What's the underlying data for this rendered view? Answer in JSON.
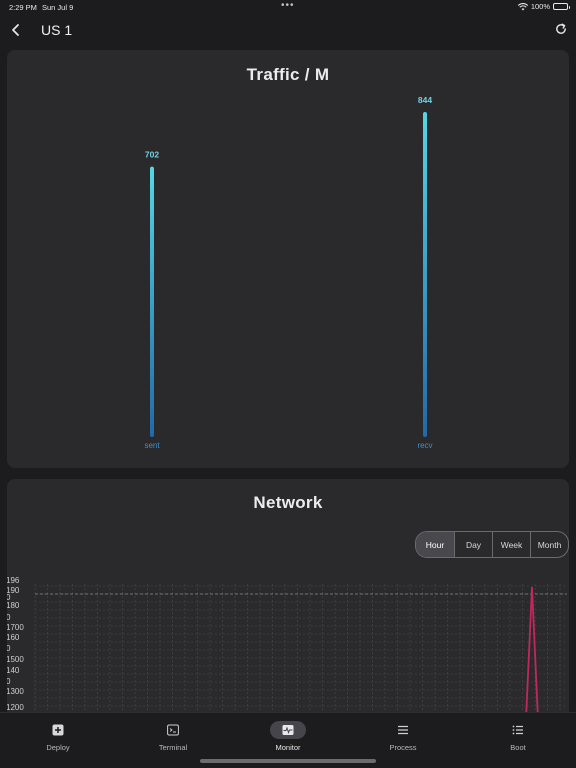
{
  "status": {
    "time": "2:29 PM",
    "date": "Sun Jul 9",
    "battery": "100%"
  },
  "nav": {
    "title": "US 1"
  },
  "traffic": {
    "title": "Traffic / M",
    "bars": [
      {
        "label": "sent",
        "value": 702
      },
      {
        "label": "recv",
        "value": 844
      }
    ]
  },
  "network": {
    "title": "Network",
    "ranges": [
      "Hour",
      "Day",
      "Week",
      "Month"
    ],
    "selected_range": "Hour",
    "axis_labels": [
      "196",
      "190",
      "0",
      "180",
      "0",
      "1700",
      "160",
      "0",
      "1500",
      "140",
      "0",
      "1300",
      "1200"
    ],
    "accent_color": "#c2275f"
  },
  "tabs": [
    {
      "label": "Deploy",
      "icon": "plus-square-icon"
    },
    {
      "label": "Terminal",
      "icon": "terminal-icon"
    },
    {
      "label": "Monitor",
      "icon": "monitor-pulse-icon"
    },
    {
      "label": "Process",
      "icon": "list-icon"
    },
    {
      "label": "Boot",
      "icon": "checklist-icon"
    }
  ],
  "active_tab": "Monitor"
}
